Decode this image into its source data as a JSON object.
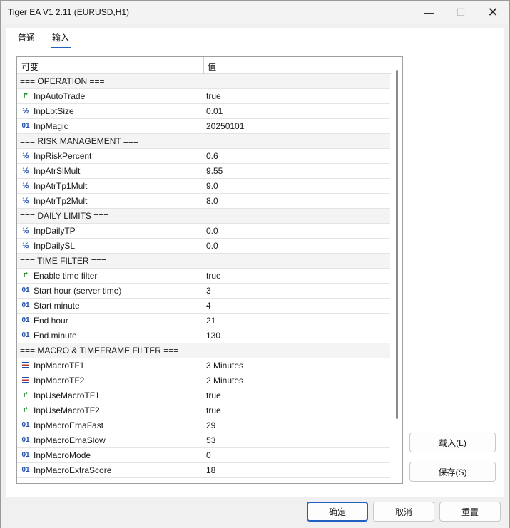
{
  "window": {
    "title": "Tiger EA V1 2.11 (EURUSD,H1)",
    "minimize_glyph": "—",
    "maximize_glyph": "☐",
    "close_glyph": "✕"
  },
  "tabs": [
    {
      "label": "普通",
      "active": false
    },
    {
      "label": "输入",
      "active": true
    }
  ],
  "grid": {
    "headers": {
      "variable": "可变",
      "value": "值"
    },
    "rows": [
      {
        "type": "section",
        "name": "=== OPERATION ===",
        "value": ""
      },
      {
        "type": "bool",
        "icon": "bool-arrow-icon",
        "name": "InpAutoTrade",
        "value": "true"
      },
      {
        "type": "frac",
        "icon": "fraction-icon",
        "name": "InpLotSize",
        "value": "0.01"
      },
      {
        "type": "int",
        "icon": "integer-icon",
        "name": "InpMagic",
        "value": "20250101"
      },
      {
        "type": "section",
        "name": "=== RISK MANAGEMENT ===",
        "value": ""
      },
      {
        "type": "frac",
        "icon": "fraction-icon",
        "name": "InpRiskPercent",
        "value": "0.6"
      },
      {
        "type": "frac",
        "icon": "fraction-icon",
        "name": "InpAtrSlMult",
        "value": "9.55"
      },
      {
        "type": "frac",
        "icon": "fraction-icon",
        "name": "InpAtrTp1Mult",
        "value": "9.0"
      },
      {
        "type": "frac",
        "icon": "fraction-icon",
        "name": "InpAtrTp2Mult",
        "value": "8.0"
      },
      {
        "type": "section",
        "name": "=== DAILY LIMITS ===",
        "value": ""
      },
      {
        "type": "frac",
        "icon": "fraction-icon",
        "name": "InpDailyTP",
        "value": "0.0"
      },
      {
        "type": "frac",
        "icon": "fraction-icon",
        "name": "InpDailySL",
        "value": "0.0"
      },
      {
        "type": "section",
        "name": "=== TIME FILTER ===",
        "value": ""
      },
      {
        "type": "bool",
        "icon": "bool-arrow-icon",
        "name": "Enable time filter",
        "value": "true"
      },
      {
        "type": "int",
        "icon": "integer-icon",
        "name": "Start hour (server time)",
        "value": "3"
      },
      {
        "type": "int",
        "icon": "integer-icon",
        "name": "Start minute",
        "value": "4"
      },
      {
        "type": "int",
        "icon": "integer-icon",
        "name": "End hour",
        "value": "21"
      },
      {
        "type": "int",
        "icon": "integer-icon",
        "name": "End minute",
        "value": "130"
      },
      {
        "type": "section",
        "name": "=== MACRO & TIMEFRAME FILTER ===",
        "value": ""
      },
      {
        "type": "enum",
        "icon": "enum-icon",
        "name": "InpMacroTF1",
        "value": "3 Minutes"
      },
      {
        "type": "enum",
        "icon": "enum-icon",
        "name": "InpMacroTF2",
        "value": "2 Minutes"
      },
      {
        "type": "bool",
        "icon": "bool-arrow-icon",
        "name": "InpUseMacroTF1",
        "value": "true"
      },
      {
        "type": "bool",
        "icon": "bool-arrow-icon",
        "name": "InpUseMacroTF2",
        "value": "true"
      },
      {
        "type": "int",
        "icon": "integer-icon",
        "name": "InpMacroEmaFast",
        "value": "29"
      },
      {
        "type": "int",
        "icon": "integer-icon",
        "name": "InpMacroEmaSlow",
        "value": "53"
      },
      {
        "type": "int",
        "icon": "integer-icon",
        "name": "InpMacroMode",
        "value": "0"
      },
      {
        "type": "int",
        "icon": "integer-icon",
        "name": "InpMacroExtraScore",
        "value": "18"
      }
    ]
  },
  "side_buttons": {
    "load": "载入(L)",
    "save": "保存(S)"
  },
  "footer": {
    "ok": "确定",
    "cancel": "取消",
    "reset": "重置"
  },
  "colors": {
    "bool_icon": "#1d8a2a",
    "numeric_icon": "#1f4fa8",
    "active_tab_underline": "#1f5fbf",
    "section_row_bg": "#f4f4f4"
  }
}
